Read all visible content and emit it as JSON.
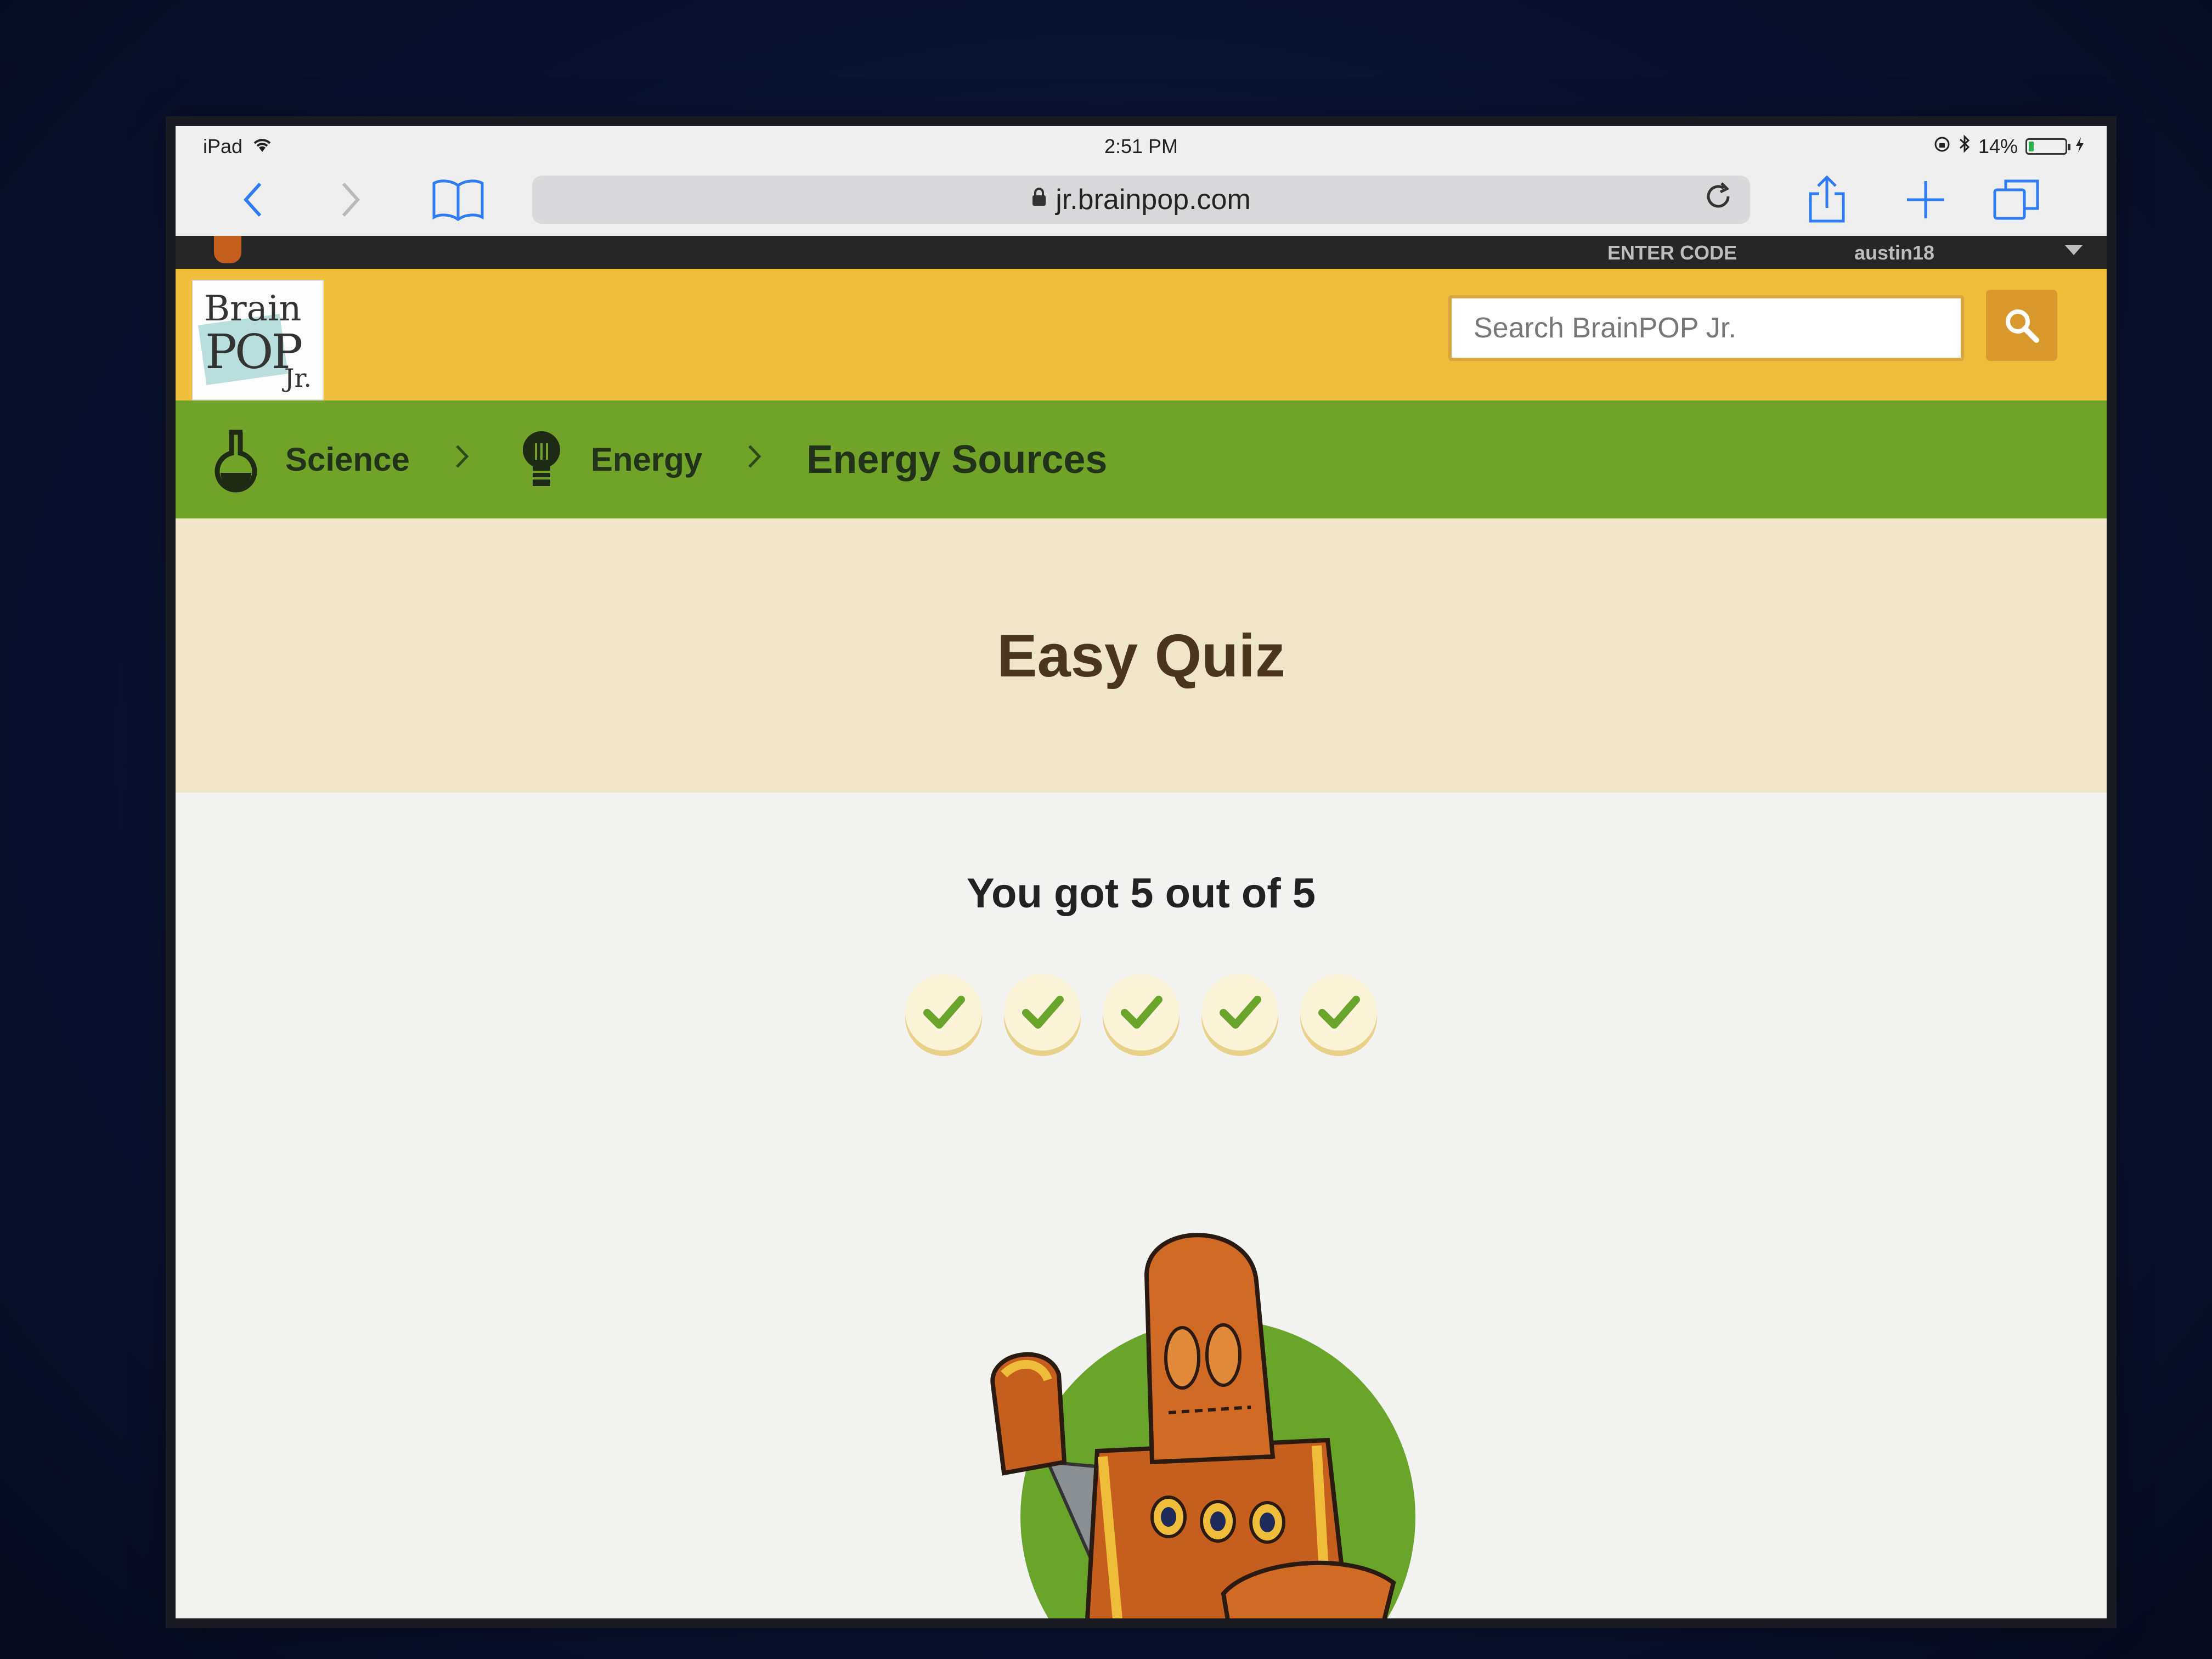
{
  "status_bar": {
    "device": "iPad",
    "time": "2:51 PM",
    "battery": "14%",
    "battery_level": 0.14
  },
  "browser": {
    "url": "jr.brainpop.com"
  },
  "top_strip": {
    "enter_code": "ENTER CODE",
    "username": "austin18"
  },
  "header": {
    "logo": {
      "line1": "Brain",
      "line2": "POP",
      "line3": "Jr."
    },
    "search_placeholder": "Search BrainPOP Jr."
  },
  "breadcrumb": [
    {
      "label": "Science",
      "icon": "flask-icon"
    },
    {
      "label": "Energy",
      "icon": "lightbulb-icon"
    },
    {
      "label": "Energy Sources"
    }
  ],
  "quiz": {
    "title": "Easy Quiz",
    "score_text": "You got 5 out of 5",
    "results": [
      true,
      true,
      true,
      true,
      true
    ]
  },
  "colors": {
    "header_yellow": "#f0bd3a",
    "breadcrumb_green": "#72a329",
    "quiz_band": "#efe5c9",
    "check_green": "#6aa52b",
    "mascot_orange": "#c65f1d"
  }
}
